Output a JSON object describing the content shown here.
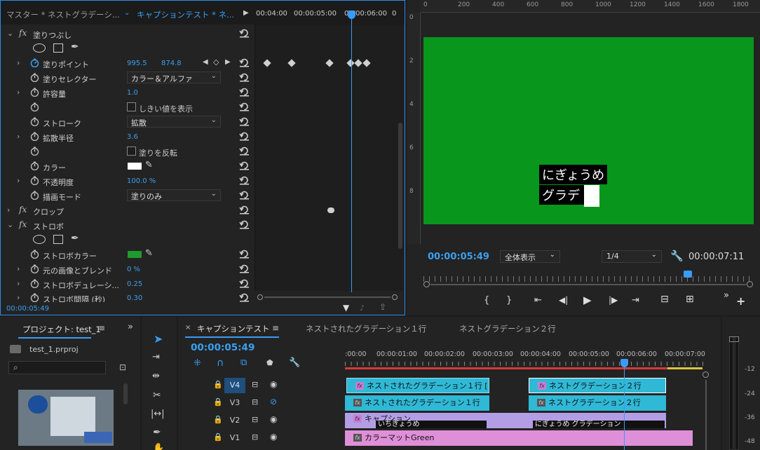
{
  "effect_controls": {
    "tab_master": "マスター * ネストグラデーシ...",
    "tab_seq": "キャプションテスト * ネ...",
    "time_marks": [
      "00:04:00",
      "00:00:05:00",
      "00:00:06:00",
      "0"
    ],
    "footer_time": "00:00:05:49",
    "rows": {
      "fill_header": "塗りつぶし",
      "fill_point": "塗りポイント",
      "fill_point_x": "995.5",
      "fill_point_y": "874.8",
      "fill_selector": "塗りセレクター",
      "fill_selector_value": "カラー＆アルファ",
      "tolerance": "許容量",
      "tolerance_value": "1.0",
      "show_threshold": "しきい値を表示",
      "stroke": "ストローク",
      "stroke_value": "拡散",
      "spread_radius": "拡散半径",
      "spread_radius_value": "3.6",
      "invert_fill": "塗りを反転",
      "color": "カラー",
      "opacity": "不透明度",
      "opacity_value": "100.0 %",
      "paint_mode": "描画モード",
      "paint_mode_value": "塗りのみ",
      "crop_header": "クロップ",
      "strobe_header": "ストロボ",
      "strobe_color": "ストロボカラー",
      "blend_original": "元の画像とブレンド",
      "blend_value": "0 %",
      "strobe_duration": "ストロボデュレーシ...",
      "strobe_duration_value": "0.25",
      "strobe_interval": "ストロボ間隔 (秒)",
      "strobe_interval_value": "0.30"
    }
  },
  "program_monitor": {
    "ruler_top": [
      "0",
      "200",
      "400",
      "600",
      "800",
      "1000",
      "1200",
      "1400",
      "1600",
      "1800"
    ],
    "ruler_left": [
      "0",
      "2",
      "4",
      "6",
      "8"
    ],
    "caption_line1": "にぎょうめ",
    "caption_line2": "グラデ",
    "current_time": "00:00:05:49",
    "zoom": "全体表示",
    "resolution": "1/4",
    "duration": "00:00:07:11",
    "colors": {
      "video_bg": "#08961c",
      "accent": "#3aa0f0"
    }
  },
  "project": {
    "title": "プロジェクト: test_1",
    "file": "test_1.prproj"
  },
  "timeline": {
    "tab_active": "キャプションテスト",
    "tab2": "ネストされたグラデーション１行",
    "tab3": "ネストグラデーション２行",
    "timecode": "00:00:05:49",
    "ruler": [
      ":00:00",
      "00:00:01:00",
      "00:00:02:00",
      "00:00:03:00",
      "00:00:04:00",
      "00:00:05:00",
      "00:00:06:00",
      "00:00:07:00"
    ],
    "tracks": [
      "V4",
      "V3",
      "V2",
      "V1"
    ],
    "clips": {
      "v4_a": "ネストされたグラデーション１行 [",
      "v4_b": "ネストグラデーション２行",
      "v3_a": "ネストされたグラデーション１行",
      "v3_b": "ネストグラデーション２行",
      "v2_a": "キャプション",
      "v2_sub1": "いちぎょうめ",
      "v2_sub2": "にぎょうめ グラデーション",
      "v1_a": "カラーマットGreen"
    }
  },
  "audio_meter": {
    "labels": [
      "-12",
      "-24",
      "-36",
      "-48"
    ]
  }
}
